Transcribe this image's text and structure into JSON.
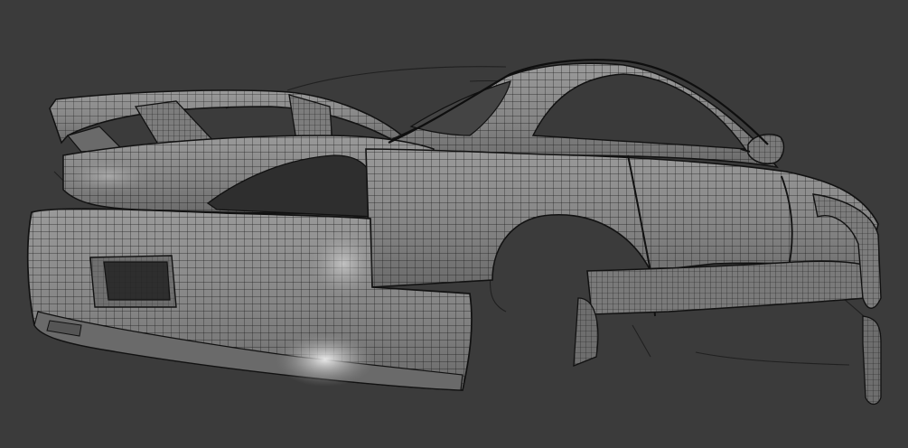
{
  "scene": {
    "subject": "car-body-wireframe",
    "colors": {
      "background": "#3b3b3b",
      "surface": "#8a8a8a",
      "surface_dark": "#5e5e5e",
      "wire": "#1c1c1c",
      "highlight": "#e6e6e6",
      "glass": "#3a3a3a"
    }
  }
}
